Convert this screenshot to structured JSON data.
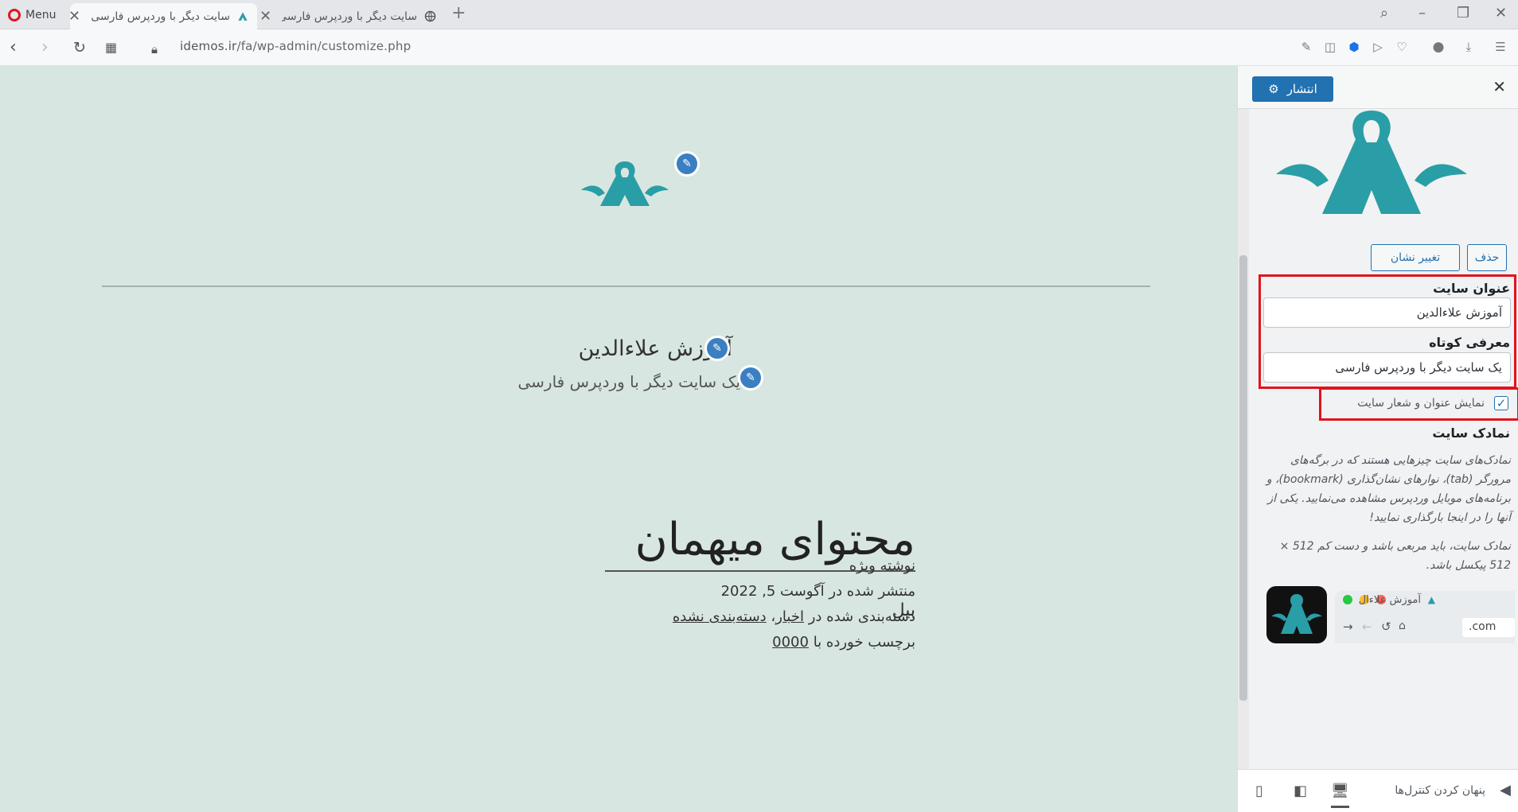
{
  "browser": {
    "menu_label": "Menu",
    "tabs": [
      {
        "title": "سایت دیگر با وردپرس فارسی",
        "active": true
      },
      {
        "title": "سایت دیگر با وردپرس فارسی",
        "active": false
      }
    ],
    "new_tab_symbol": "+",
    "url_host": "idemos.ir",
    "url_path": "/fa/wp-admin/customize.php"
  },
  "preview": {
    "site_title": "آموزش علاءالدین",
    "tagline": "یک سایت دیگر با وردپرس فارسی",
    "post_title": "محتوای میهمان",
    "post_excerpt": "بیل",
    "meta_featured": "نوشته ویژه",
    "meta_published": "منتشر شده در آگوست 5, 2022",
    "meta_categories_prefix": "دسته‌بندی شده در",
    "meta_category_1": "اخبار",
    "meta_category_2": "دسته‌بندی نشده",
    "meta_tags_prefix": "برچسب خورده با",
    "meta_tag_1": "0000",
    "colors": {
      "background": "#d8e6e2",
      "logo": "#2a9ea6",
      "edit_button": "#3a7fc1"
    }
  },
  "customizer": {
    "publish_label": "انتشار",
    "remove_label": "حذف",
    "change_logo_label": "تغییر نشان",
    "site_title_label": "عنوان سایت",
    "site_title_value": "آموزش علاءالدین",
    "tagline_label": "معرفی کوتاه",
    "tagline_value": "یک سایت دیگر با وردپرس فارسی",
    "display_title_label": "نمایش عنوان و شعار سایت",
    "display_title_checked": true,
    "site_icon_heading": "نمادک سایت",
    "site_icon_desc": "نمادک‌های سایت چیزهایی هستند که در برگه‌های مرورگر (tab)، نوارهای نشان‌گذاری (bookmark)، و برنامه‌های موبایل وردپرس مشاهده می‌نمایید. یکی از آنها را در اینجا بارگذاری نمایید!",
    "site_icon_req": "نمادک سایت، باید مربعی باشد و دست کم 512 × 512 پیکسل باشد.",
    "icon_preview_tab": "آموزش علاءال",
    "icon_preview_url": ".com",
    "hide_controls_label": "پنهان کردن کنترل‌ها",
    "colors": {
      "highlight": "#e0141e",
      "primary": "#2271b1"
    }
  }
}
